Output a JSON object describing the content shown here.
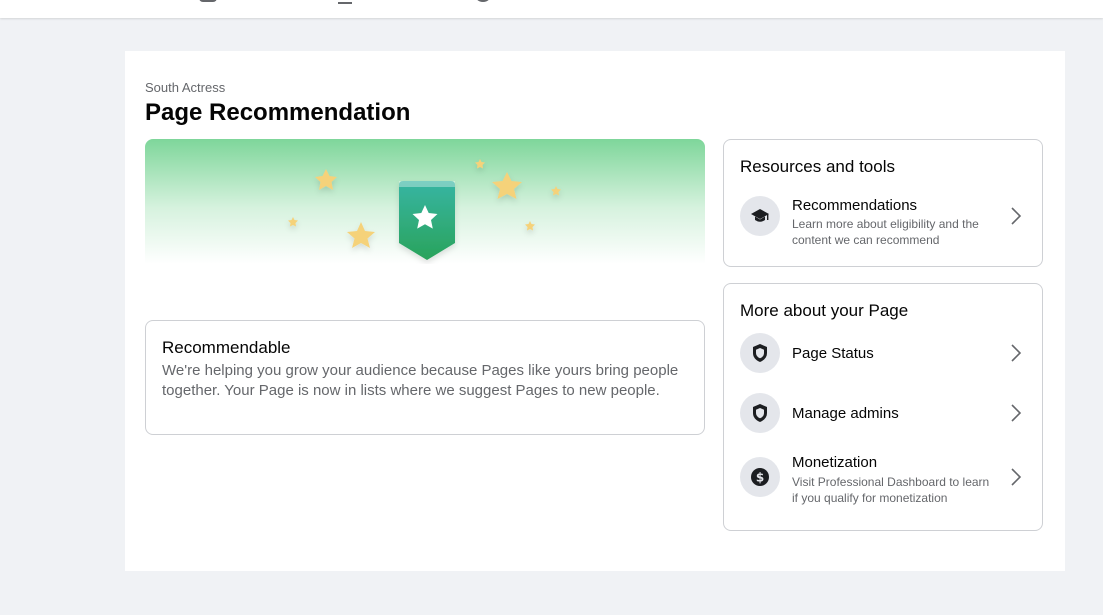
{
  "header": {
    "breadcrumb": "South Actress",
    "title": "Page Recommendation"
  },
  "hero": {
    "icon": "star-badge-icon",
    "gradient_color": "#7ed69a",
    "badge_color": "#2aa889",
    "star_color": "#f5d27a"
  },
  "status_card": {
    "title": "Recommendable",
    "description": "We're helping you grow your audience because Pages like yours bring people together. Your Page is now in lists where we suggest Pages to new people."
  },
  "resources": {
    "title": "Resources and tools",
    "items": [
      {
        "icon": "graduation-cap-icon",
        "title": "Recommendations",
        "description": "Learn more about eligibility and the content we can recommend"
      }
    ]
  },
  "more_about": {
    "title": "More about your Page",
    "items": [
      {
        "icon": "shield-icon",
        "title": "Page Status"
      },
      {
        "icon": "shield-icon",
        "title": "Manage admins"
      },
      {
        "icon": "dollar-icon",
        "title": "Monetization",
        "description": "Visit Professional Dashboard to learn if you qualify for monetization"
      }
    ]
  }
}
